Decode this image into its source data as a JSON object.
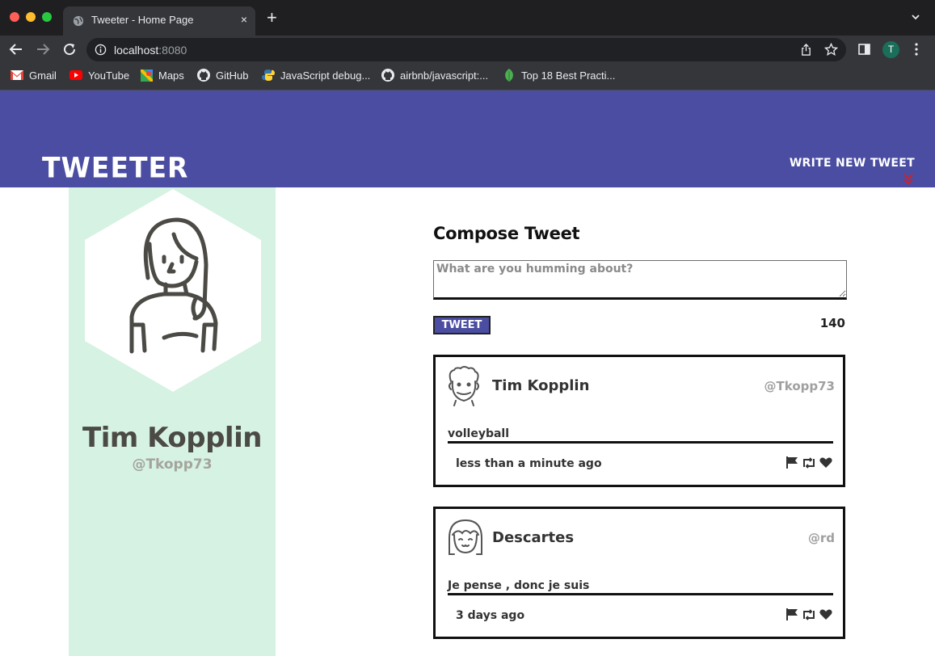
{
  "browser": {
    "tab_title": "Tweeter - Home Page",
    "tab_close": "×",
    "new_tab": "+",
    "url_host": "localhost",
    "url_port": ":8080",
    "profile_initial": "T",
    "bookmarks": [
      {
        "label": "Gmail",
        "icon": "gmail-icon"
      },
      {
        "label": "YouTube",
        "icon": "youtube-icon"
      },
      {
        "label": "Maps",
        "icon": "maps-icon"
      },
      {
        "label": "GitHub",
        "icon": "github-icon"
      },
      {
        "label": "JavaScript debug...",
        "icon": "python-icon"
      },
      {
        "label": "airbnb/javascript:...",
        "icon": "github-icon"
      },
      {
        "label": "Top 18 Best Practi...",
        "icon": "leaf-icon"
      }
    ]
  },
  "header": {
    "logo": "Tweeter",
    "write_new": "Write new tweet",
    "accent_color": "#4a4da1",
    "arrow_color": "#d0202a"
  },
  "profile": {
    "name": "Tim Kopplin",
    "handle": "@Tkopp73",
    "panel_color": "#d5f2e3"
  },
  "compose": {
    "title": "Compose Tweet",
    "placeholder": "What are you humming about?",
    "button": "Tweet",
    "counter": "140"
  },
  "tweets": [
    {
      "name": "Tim Kopplin",
      "handle": "@Tkopp73",
      "content": "volleyball",
      "time": "less than a minute ago",
      "avatar": "curly-hair-avatar-icon"
    },
    {
      "name": "Descartes",
      "handle": "@rd",
      "content": "Je pense , donc je suis",
      "time": "3 days ago",
      "avatar": "bangs-avatar-icon"
    }
  ]
}
